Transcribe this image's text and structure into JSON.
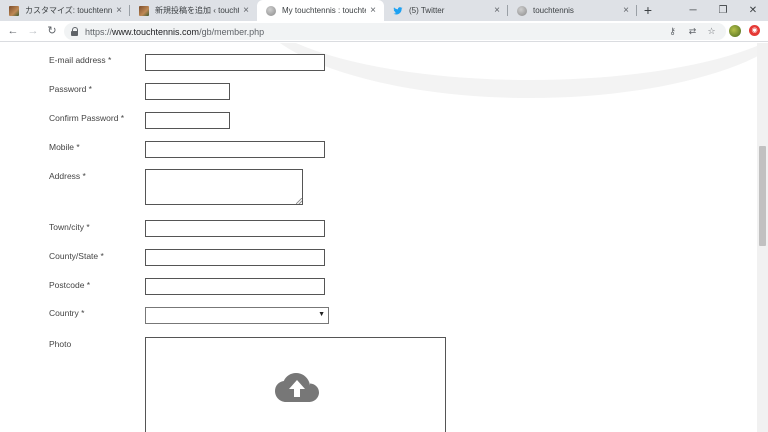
{
  "browser": {
    "tabs": [
      {
        "title": "カスタマイズ: touchtennis Japan",
        "favicon": "photo-icon",
        "active": false
      },
      {
        "title": "新規投稿を追加 ‹ touchtennis",
        "favicon": "photo-icon",
        "active": false
      },
      {
        "title": "My touchtennis : touchtennis",
        "favicon": "globe-icon",
        "active": true
      },
      {
        "title": "(5) Twitter",
        "favicon": "twitter-icon",
        "active": false
      },
      {
        "title": "touchtennis",
        "favicon": "globe-icon",
        "active": false
      }
    ],
    "close_glyph": "×",
    "new_tab_glyph": "+",
    "window_controls": {
      "minimize": "─",
      "maximize": "❐",
      "close": "✕"
    },
    "nav": {
      "back": "←",
      "forward": "→",
      "reload": "↻"
    },
    "url_scheme": "https://",
    "url_host": "www.touchtennis.com",
    "url_path": "/gb/member.php",
    "toolbar_icons": {
      "key": "⚷",
      "translate": "⇄",
      "bookmark": "☆",
      "menu": "⋮",
      "extension": "◉"
    }
  },
  "form": {
    "email_label": "E-mail address *",
    "email_value": "",
    "password_label": "Password *",
    "password_value": "",
    "confirm_password_label": "Confirm Password *",
    "confirm_password_value": "",
    "mobile_label": "Mobile *",
    "mobile_value": "",
    "address_label": "Address *",
    "address_value": "",
    "town_label": "Town/city *",
    "town_value": "",
    "county_label": "County/State *",
    "county_value": "",
    "postcode_label": "Postcode *",
    "postcode_value": "",
    "country_label": "Country *",
    "country_value": "",
    "country_arrow": "▼",
    "photo_label": "Photo"
  },
  "colors": {
    "upload_icon": "#777777",
    "twitter_blue": "#1da1f2",
    "field_border": "#555555"
  }
}
